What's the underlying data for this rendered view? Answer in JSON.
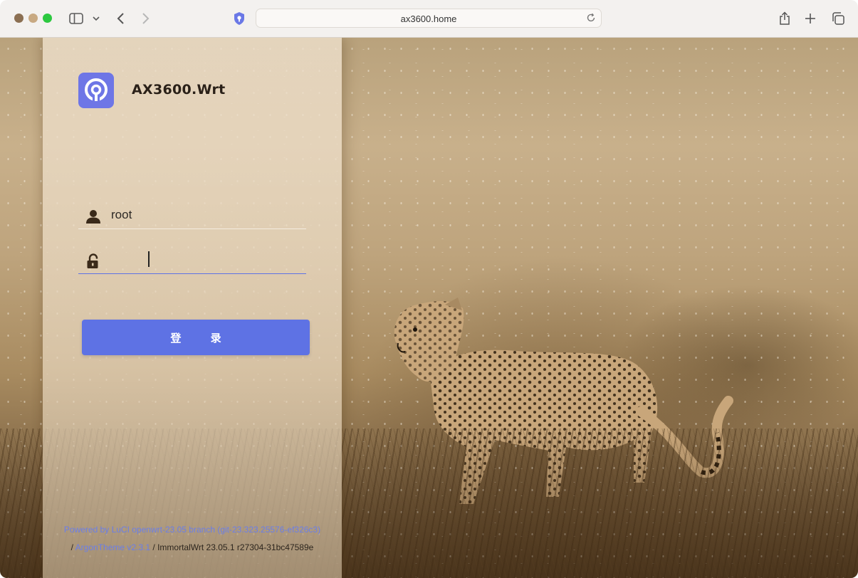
{
  "browser": {
    "url": "ax3600.home"
  },
  "login": {
    "brand": "AX3600.Wrt",
    "username_value": "root",
    "password_value": "",
    "login_label": "登 录"
  },
  "footer": {
    "powered_link": "Powered by LuCI openwrt-23.05 branch (git-23.323.25576-ef326c3)",
    "separator": "/",
    "theme_link": "ArgonTheme v2.3.1",
    "version_text": "/ ImmortalWrt 23.05.1 r27304-31bc47589e"
  },
  "colors": {
    "accent": "#5e72e4",
    "logo_bg": "#6e76e6"
  },
  "icons": [
    "sidebar-icon",
    "chevron-down-icon",
    "back-arrow-icon",
    "forward-arrow-icon",
    "password-shield-icon",
    "reload-icon",
    "share-icon",
    "new-tab-icon",
    "tabs-overview-icon",
    "openwrt-logo-icon",
    "user-icon",
    "lock-icon"
  ]
}
